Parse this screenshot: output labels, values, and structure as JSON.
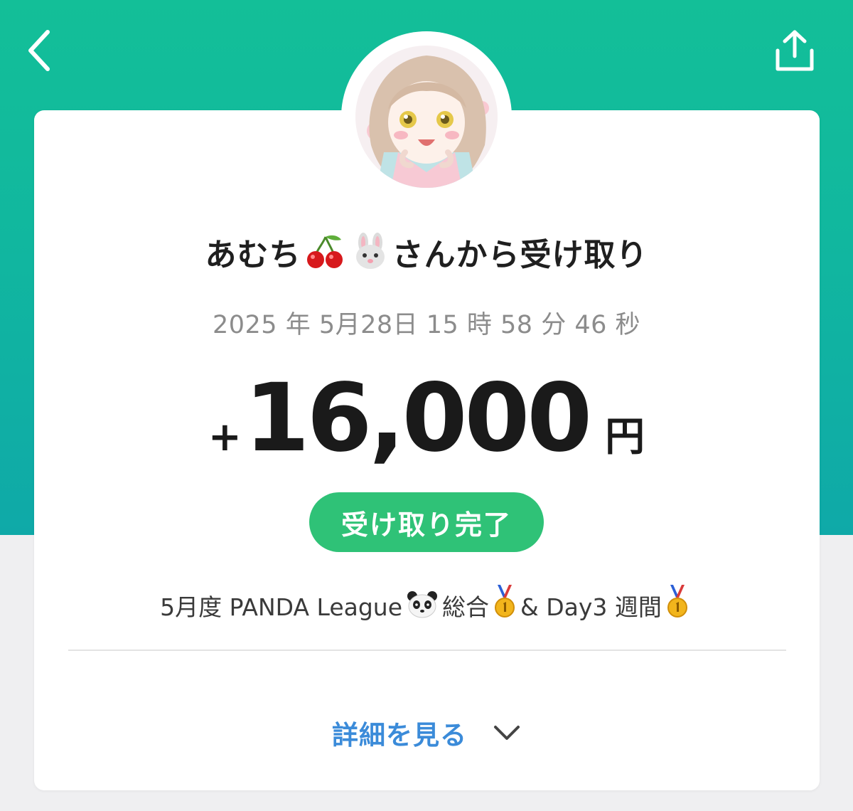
{
  "header": {
    "back_icon": "chevron-left-icon",
    "share_icon": "share-icon",
    "colors": {
      "gradient_top": "#13bf98",
      "gradient_bottom": "#0fa9a8"
    }
  },
  "transaction": {
    "sender_name": "あむち",
    "sender_emojis": [
      "cherry-emoji",
      "rabbit-face-emoji"
    ],
    "title_suffix": "さんから受け取り",
    "datetime": "2025 年 5月28日 15 時 58 分 46 秒",
    "amount_sign": "+",
    "amount": "16,000",
    "currency": "円",
    "status": "受け取り完了",
    "status_color": "#2fc277",
    "message_part1": "5月度 PANDA League",
    "message_part2": "総合",
    "message_part3": "& Day3 週間",
    "message_emojis": [
      "panda-face-emoji",
      "gold-medal-emoji",
      "gold-medal-emoji"
    ]
  },
  "details": {
    "label": "詳細を見る",
    "icon": "chevron-down-icon",
    "color": "#3b8bd9"
  }
}
